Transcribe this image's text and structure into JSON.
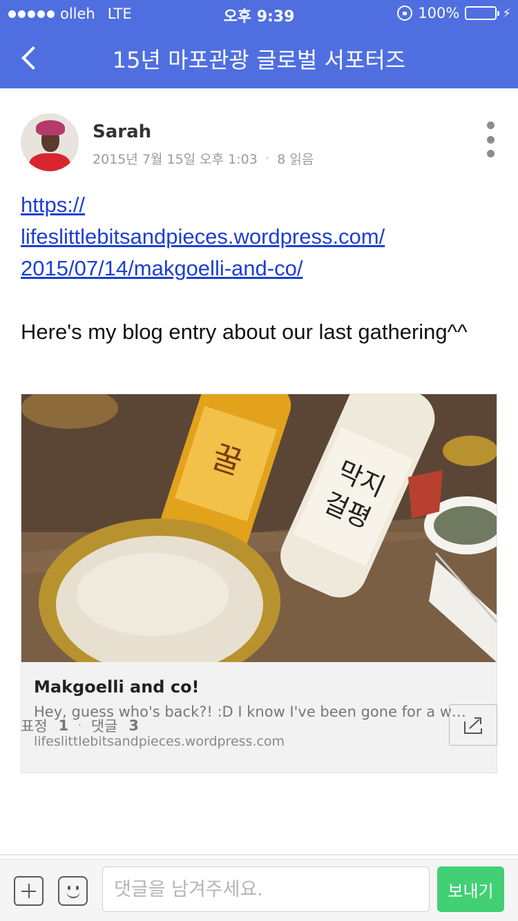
{
  "status_bar": {
    "carrier": "olleh",
    "network": "LTE",
    "time": "오후 9:39",
    "battery": "100%",
    "battery_level": 1.0
  },
  "header": {
    "back_icon": "chevron-left-icon",
    "title": "15년 마포관광 글로벌 서포터즈",
    "background_color": "#4f6fe0"
  },
  "post": {
    "author": "Sarah",
    "date": "2015년 7월 15일 오후 1:03",
    "meta_separator": "·",
    "reads": "8 읽음",
    "link_line1": "https://",
    "link_line2": "lifeslittlebitsandpieces.wordpress.com/",
    "link_line3": "2015/07/14/makgoelli-and-co/",
    "body": "Here's my blog entry about our last gathering^^"
  },
  "link_preview": {
    "title": "Makgoelli and co!",
    "description": "Hey, guess who's back?! :D I know I've been gone for a w…",
    "domain": "lifeslittlebitsandpieces.wordpress.com"
  },
  "stats": {
    "reactions_label": "표정",
    "reactions_count": "1",
    "separator": "·",
    "comments_label": "댓글",
    "comments_count": "3"
  },
  "composer": {
    "placeholder": "댓글을 남겨주세요.",
    "send_label": "보내기",
    "send_color": "#41d074"
  }
}
